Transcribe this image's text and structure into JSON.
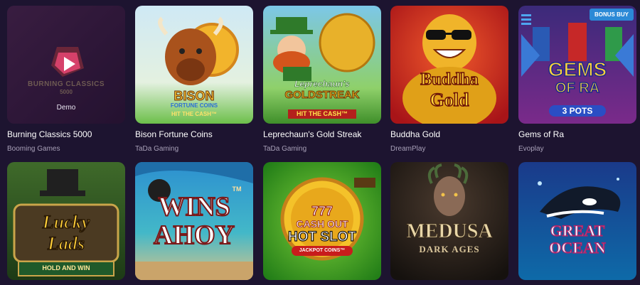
{
  "colors": {
    "background": "#1d1430",
    "provider_text": "#a8a0b8",
    "badge": "#2b89d6"
  },
  "row1": [
    {
      "name": "Burning Classics 5000",
      "provider": "Booming Games",
      "logo_line1": "BURNING CLASSICS",
      "logo_line2": "5000",
      "demo": "Demo"
    },
    {
      "name": "Bison Fortune Coins",
      "provider": "TaDa Gaming",
      "logo_line1": "BISON",
      "logo_line2": "FORTUNE COINS",
      "logo_line3": "HIT THE CASH™"
    },
    {
      "name": "Leprechaun's Gold Streak",
      "provider": "TaDa Gaming",
      "logo_line1": "Leprechaun's",
      "logo_line2": "GOLDSTREAK",
      "logo_line3": "HIT THE CASH™"
    },
    {
      "name": "Buddha Gold",
      "provider": "DreamPlay",
      "logo_line1": "Buddha",
      "logo_line2": "Gold"
    },
    {
      "name": "Gems of Ra",
      "provider": "Evoplay",
      "logo_line1": "GEMS",
      "logo_line2": "OF RA",
      "logo_line3": "3 POTS",
      "badge": "BONUS BUY"
    }
  ],
  "row2": [
    {
      "logo_line1": "Lucky",
      "logo_line2": "Lads",
      "logo_line3": "HOLD AND WIN"
    },
    {
      "logo_line1": "WINS",
      "logo_line2": "AHOY",
      "tm": "TM"
    },
    {
      "logo_line1": "777",
      "logo_line2": "CASH OUT",
      "logo_line3": "HOT SLOT",
      "logo_line4": "JACKPOT COINS™"
    },
    {
      "logo_line1": "MEDUSA",
      "logo_line2": "DARK AGES"
    },
    {
      "logo_line1": "GREAT",
      "logo_line2": "OCEAN"
    }
  ]
}
